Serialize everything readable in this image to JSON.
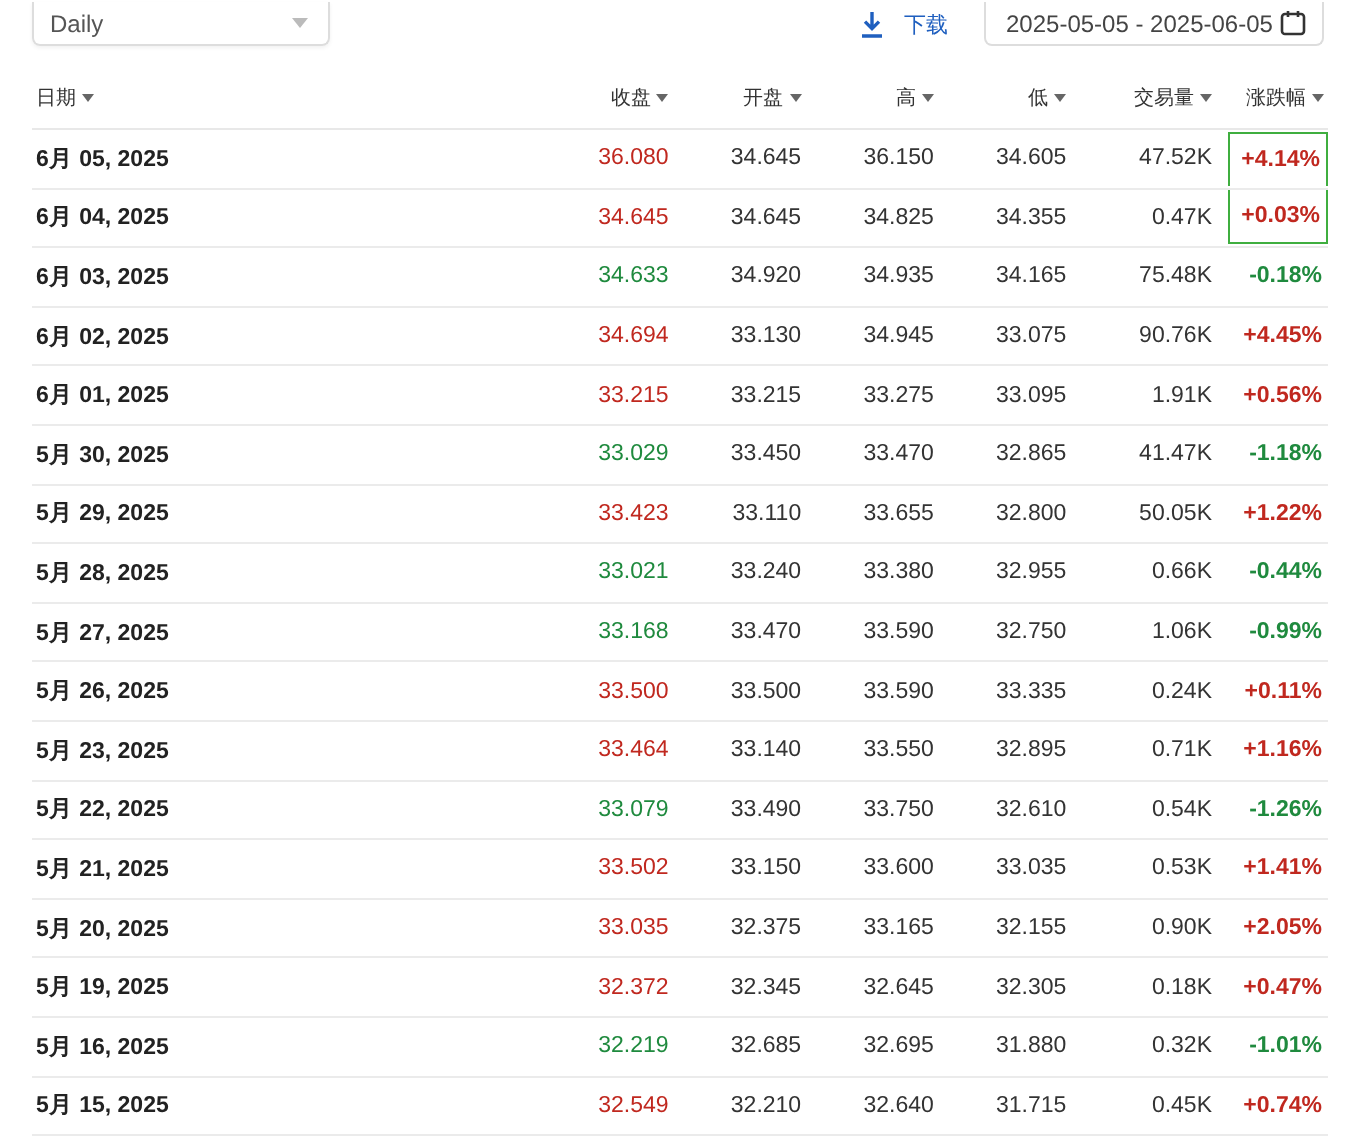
{
  "toolbar": {
    "interval": "Daily",
    "download": "下载",
    "date_range": "2025-05-05 - 2025-06-05"
  },
  "table": {
    "columns": [
      "日期",
      "收盘",
      "开盘",
      "高",
      "低",
      "交易量",
      "涨跌幅"
    ],
    "rows": [
      {
        "date": "6月 05, 2025",
        "close": "36.080",
        "open": "34.645",
        "high": "36.150",
        "low": "34.605",
        "volume": "47.52K",
        "change": "+4.14%",
        "rising": true,
        "highlighted": true
      },
      {
        "date": "6月 04, 2025",
        "close": "34.645",
        "open": "34.645",
        "high": "34.825",
        "low": "34.355",
        "volume": "0.47K",
        "change": "+0.03%",
        "rising": true,
        "highlighted": true
      },
      {
        "date": "6月 03, 2025",
        "close": "34.633",
        "open": "34.920",
        "high": "34.935",
        "low": "34.165",
        "volume": "75.48K",
        "change": "-0.18%",
        "rising": false,
        "highlighted": false
      },
      {
        "date": "6月 02, 2025",
        "close": "34.694",
        "open": "33.130",
        "high": "34.945",
        "low": "33.075",
        "volume": "90.76K",
        "change": "+4.45%",
        "rising": true,
        "highlighted": false
      },
      {
        "date": "6月 01, 2025",
        "close": "33.215",
        "open": "33.215",
        "high": "33.275",
        "low": "33.095",
        "volume": "1.91K",
        "change": "+0.56%",
        "rising": true,
        "highlighted": false
      },
      {
        "date": "5月 30, 2025",
        "close": "33.029",
        "open": "33.450",
        "high": "33.470",
        "low": "32.865",
        "volume": "41.47K",
        "change": "-1.18%",
        "rising": false,
        "highlighted": false
      },
      {
        "date": "5月 29, 2025",
        "close": "33.423",
        "open": "33.110",
        "high": "33.655",
        "low": "32.800",
        "volume": "50.05K",
        "change": "+1.22%",
        "rising": true,
        "highlighted": false
      },
      {
        "date": "5月 28, 2025",
        "close": "33.021",
        "open": "33.240",
        "high": "33.380",
        "low": "32.955",
        "volume": "0.66K",
        "change": "-0.44%",
        "rising": false,
        "highlighted": false
      },
      {
        "date": "5月 27, 2025",
        "close": "33.168",
        "open": "33.470",
        "high": "33.590",
        "low": "32.750",
        "volume": "1.06K",
        "change": "-0.99%",
        "rising": false,
        "highlighted": false
      },
      {
        "date": "5月 26, 2025",
        "close": "33.500",
        "open": "33.500",
        "high": "33.590",
        "low": "33.335",
        "volume": "0.24K",
        "change": "+0.11%",
        "rising": true,
        "highlighted": false
      },
      {
        "date": "5月 23, 2025",
        "close": "33.464",
        "open": "33.140",
        "high": "33.550",
        "low": "32.895",
        "volume": "0.71K",
        "change": "+1.16%",
        "rising": true,
        "highlighted": false
      },
      {
        "date": "5月 22, 2025",
        "close": "33.079",
        "open": "33.490",
        "high": "33.750",
        "low": "32.610",
        "volume": "0.54K",
        "change": "-1.26%",
        "rising": false,
        "highlighted": false
      },
      {
        "date": "5月 21, 2025",
        "close": "33.502",
        "open": "33.150",
        "high": "33.600",
        "low": "33.035",
        "volume": "0.53K",
        "change": "+1.41%",
        "rising": true,
        "highlighted": false
      },
      {
        "date": "5月 20, 2025",
        "close": "33.035",
        "open": "32.375",
        "high": "33.165",
        "low": "32.155",
        "volume": "0.90K",
        "change": "+2.05%",
        "rising": true,
        "highlighted": false
      },
      {
        "date": "5月 19, 2025",
        "close": "32.372",
        "open": "32.345",
        "high": "32.645",
        "low": "32.305",
        "volume": "0.18K",
        "change": "+0.47%",
        "rising": true,
        "highlighted": false
      },
      {
        "date": "5月 16, 2025",
        "close": "32.219",
        "open": "32.685",
        "high": "32.695",
        "low": "31.880",
        "volume": "0.32K",
        "change": "-1.01%",
        "rising": false,
        "highlighted": false
      },
      {
        "date": "5月 15, 2025",
        "close": "32.549",
        "open": "32.210",
        "high": "32.640",
        "low": "31.715",
        "volume": "0.45K",
        "change": "+0.74%",
        "rising": true,
        "highlighted": false
      }
    ]
  }
}
